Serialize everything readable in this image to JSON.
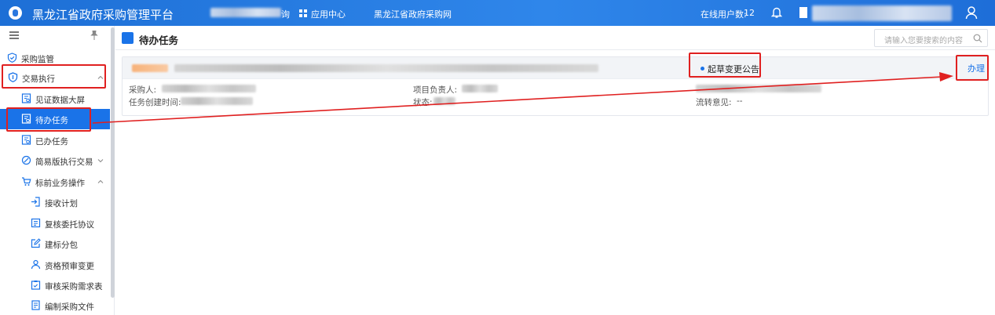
{
  "header": {
    "title": "黑龙江省政府采购管理平台",
    "app_center_suffix": "询",
    "app_center": "应用中心",
    "portal_link": "黑龙江省政府采购网",
    "online_users_label": "在线用户数:",
    "online_users_count": "12"
  },
  "sidebar": {
    "items": [
      {
        "label": "采购监管"
      },
      {
        "label": "交易执行"
      },
      {
        "label": "见证数据大屏"
      },
      {
        "label": "待办任务"
      },
      {
        "label": "已办任务"
      },
      {
        "label": "简易版执行交易"
      },
      {
        "label": "标前业务操作"
      },
      {
        "label": "接收计划"
      },
      {
        "label": "复核委托协议"
      },
      {
        "label": "建标分包"
      },
      {
        "label": "资格预审变更"
      },
      {
        "label": "审核采购需求表"
      },
      {
        "label": "编制采购文件"
      }
    ]
  },
  "main": {
    "page_title": "待办任务",
    "search_placeholder": "请输入您要搜索的内容",
    "task": {
      "type": "起草变更公告",
      "action": "办理",
      "purchaser_label": "采购人:",
      "created_label": "任务创建时间:",
      "owner_label": "项目负责人:",
      "status_label": "状态:",
      "flow_label": "流转意见:",
      "flow_value": "--"
    }
  },
  "colors": {
    "brand": "#1a73e8",
    "annotation": "#e02020"
  }
}
